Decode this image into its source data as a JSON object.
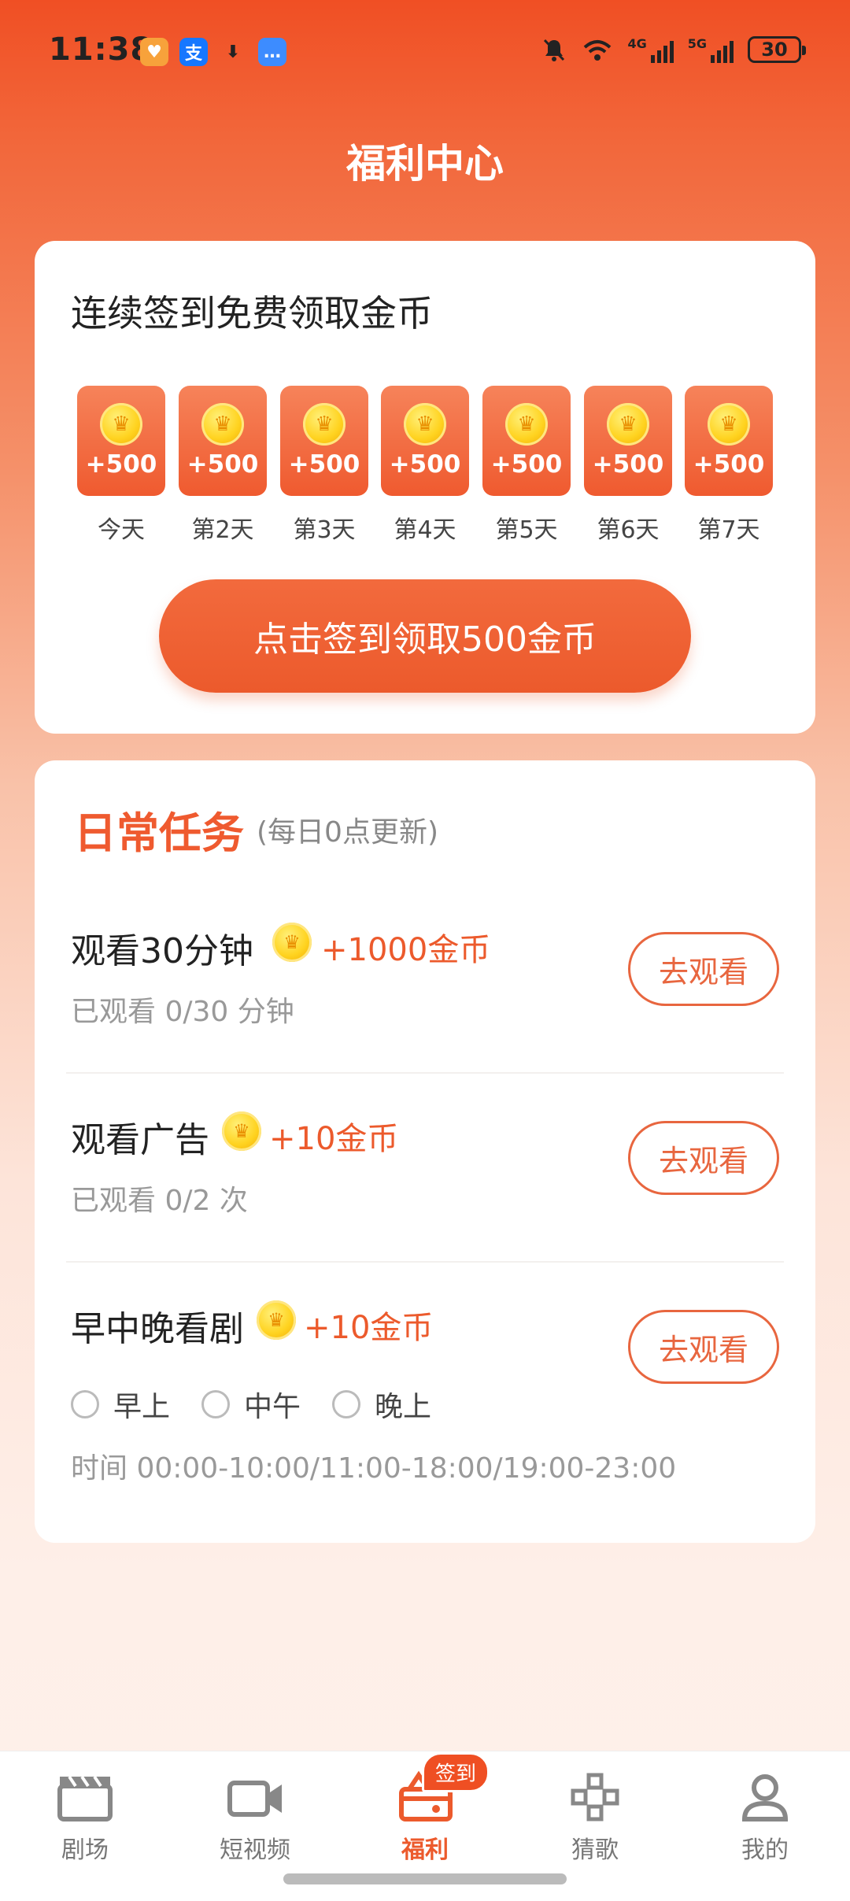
{
  "status_bar": {
    "time": "11:38",
    "battery": "30",
    "signal_tags": [
      "4G",
      "5G"
    ],
    "icons": [
      "heart-app-icon",
      "alipay-icon",
      "download-icon",
      "message-icon",
      "mute-icon",
      "wifi-icon"
    ]
  },
  "page_title": "福利中心",
  "signin": {
    "title": "连续签到免费领取金币",
    "days": [
      {
        "amount": "+500",
        "label": "今天"
      },
      {
        "amount": "+500",
        "label": "第2天"
      },
      {
        "amount": "+500",
        "label": "第3天"
      },
      {
        "amount": "+500",
        "label": "第4天"
      },
      {
        "amount": "+500",
        "label": "第5天"
      },
      {
        "amount": "+500",
        "label": "第6天"
      },
      {
        "amount": "+500",
        "label": "第7天"
      }
    ],
    "button": "点击签到领取500金币"
  },
  "daily": {
    "title": "日常任务",
    "subtitle": "(每日0点更新)",
    "tasks": [
      {
        "name": "观看30分钟",
        "reward": "+1000金币",
        "progress": "已观看 0/30 分钟",
        "button": "去观看"
      },
      {
        "name": "观看广告",
        "reward": "+10金币",
        "progress": "已观看 0/2 次",
        "button": "去观看"
      },
      {
        "name": "早中晚看剧",
        "reward": "+10金币",
        "options": [
          "早上",
          "中午",
          "晚上"
        ],
        "time_note": "时间 00:00-10:00/11:00-18:00/19:00-23:00",
        "button": "去观看"
      }
    ]
  },
  "nav": {
    "items": [
      {
        "label": "剧场",
        "icon": "clapperboard-icon"
      },
      {
        "label": "短视频",
        "icon": "video-camera-icon"
      },
      {
        "label": "福利",
        "icon": "gift-icon"
      },
      {
        "label": "猜歌",
        "icon": "gamepad-icon"
      },
      {
        "label": "我的",
        "icon": "person-icon"
      }
    ],
    "badge": "签到",
    "active": "福利"
  },
  "colors": {
    "brand": "#ec5a2c",
    "header_gradient_top": "#f04f24"
  }
}
